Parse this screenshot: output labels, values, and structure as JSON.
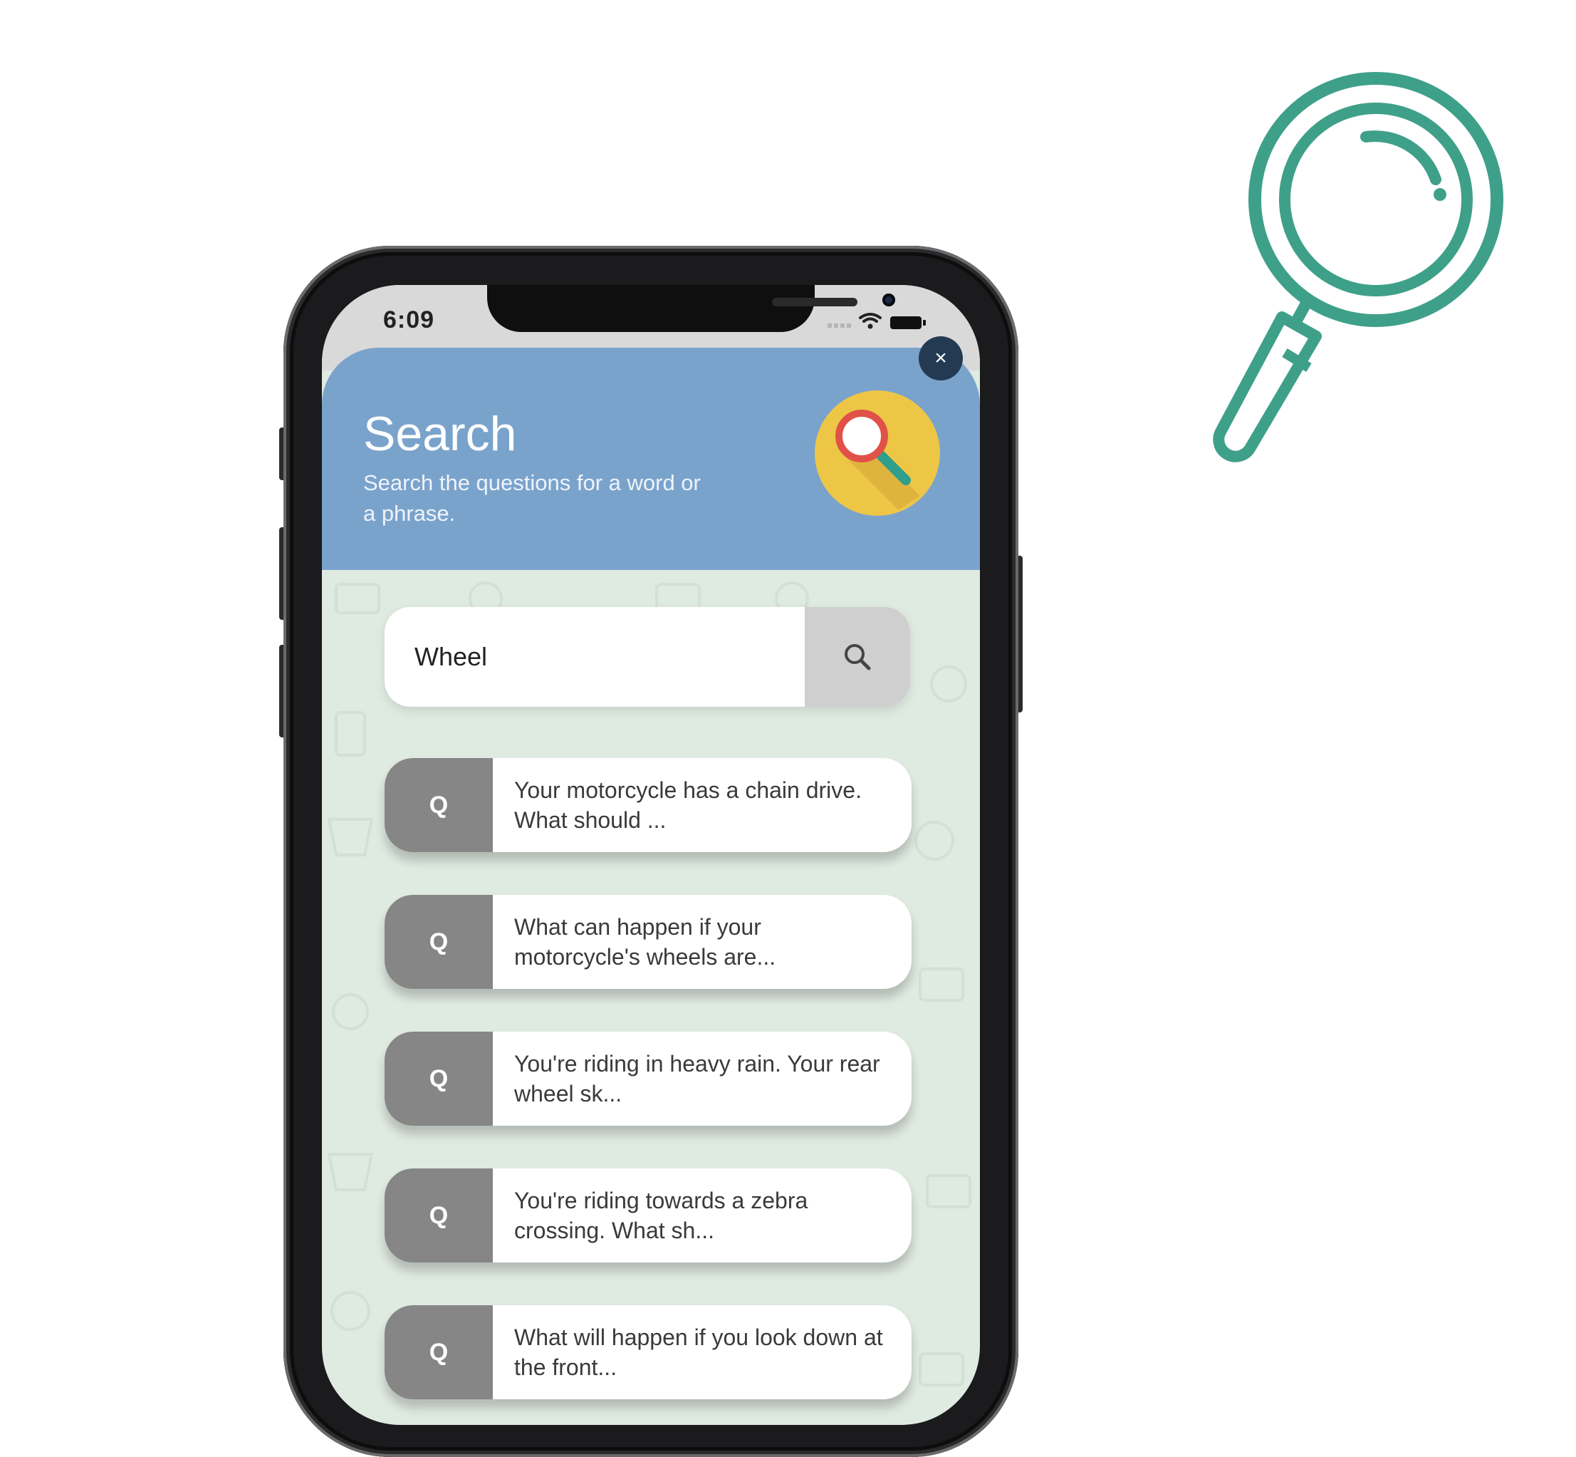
{
  "status_bar": {
    "time": "6:09"
  },
  "header": {
    "title": "Search",
    "subtitle": "Search the questions for a word or a phrase.",
    "close_label": "×"
  },
  "search": {
    "value": "Wheel"
  },
  "results": [
    {
      "badge": "Q",
      "text": "Your motorcycle has a chain drive. What should ..."
    },
    {
      "badge": "Q",
      "text": "What can happen if your motorcycle's wheels are..."
    },
    {
      "badge": "Q",
      "text": "You're riding in heavy rain. Your rear wheel sk..."
    },
    {
      "badge": "Q",
      "text": "You're riding towards a zebra crossing. What sh..."
    },
    {
      "badge": "Q",
      "text": "What will happen if you look down at the front..."
    }
  ],
  "colors": {
    "header": "#7aa3cc",
    "accent_green": "#3fa08a",
    "badge_grey": "#868686",
    "close_button": "#243a52"
  },
  "icons": {
    "decorative": "magnifier-icon",
    "header": "search-badge-icon",
    "search_button": "search-icon",
    "close": "close-icon"
  }
}
